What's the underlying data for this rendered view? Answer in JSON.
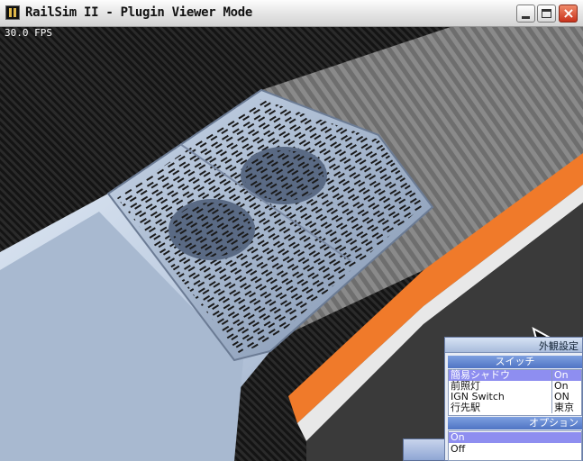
{
  "window": {
    "title": "RailSim II - Plugin Viewer Mode"
  },
  "viewport": {
    "fps": "30.0 FPS"
  },
  "panel": {
    "title": "外観設定",
    "switch_header": "スイッチ",
    "switches": [
      {
        "name": "簡易シャドウ",
        "value": "On"
      },
      {
        "name": "前照灯",
        "value": "On"
      },
      {
        "name": "IGN Switch",
        "value": "ON"
      },
      {
        "name": "行先駅",
        "value": "東京"
      }
    ],
    "option_header": "オプション",
    "options": [
      "On",
      "Off"
    ]
  },
  "colors": {
    "roof": "#b8c8dc",
    "stripe": "#f07a2a",
    "selection": "#8e8ef0"
  }
}
